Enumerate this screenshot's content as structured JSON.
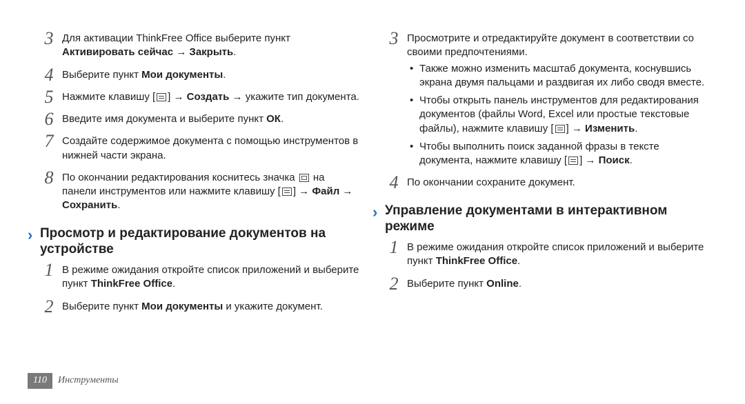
{
  "left": {
    "steps": [
      {
        "num": "3",
        "parts": [
          {
            "t": "Для активации ThinkFree Office выберите пункт "
          },
          {
            "t": "Активировать сейчас",
            "b": true
          },
          {
            "t": " → "
          },
          {
            "t": "Закрыть",
            "b": true
          },
          {
            "t": "."
          }
        ]
      },
      {
        "num": "4",
        "parts": [
          {
            "t": "Выберите пункт "
          },
          {
            "t": "Мои документы",
            "b": true
          },
          {
            "t": "."
          }
        ]
      },
      {
        "num": "5",
        "parts": [
          {
            "t": "Нажмите клавишу ["
          },
          {
            "icon": "menu"
          },
          {
            "t": "] → "
          },
          {
            "t": "Создать",
            "b": true
          },
          {
            "t": " → укажите тип документа."
          }
        ]
      },
      {
        "num": "6",
        "parts": [
          {
            "t": "Введите имя документа и выберите пункт "
          },
          {
            "t": "ОК",
            "b": true
          },
          {
            "t": "."
          }
        ]
      },
      {
        "num": "7",
        "parts": [
          {
            "t": "Создайте содержимое документа с помощью инструментов в нижней части экрана."
          }
        ]
      },
      {
        "num": "8",
        "parts": [
          {
            "t": "По окончании редактирования коснитесь значка "
          },
          {
            "icon": "save"
          },
          {
            "t": " на панели инструментов или нажмите клавишу ["
          },
          {
            "icon": "menu"
          },
          {
            "t": "] → "
          },
          {
            "t": "Файл",
            "b": true
          },
          {
            "t": " → "
          },
          {
            "t": "Сохранить",
            "b": true
          },
          {
            "t": "."
          }
        ]
      }
    ],
    "heading": "Просмотр и редактирование документов на устройстве",
    "steps2": [
      {
        "num": "1",
        "parts": [
          {
            "t": "В режиме ожидания откройте список приложений и выберите пункт "
          },
          {
            "t": "ThinkFree Office",
            "b": true
          },
          {
            "t": "."
          }
        ]
      },
      {
        "num": "2",
        "parts": [
          {
            "t": "Выберите пункт "
          },
          {
            "t": "Мои документы",
            "b": true
          },
          {
            "t": " и укажите документ."
          }
        ]
      }
    ]
  },
  "right": {
    "step3": {
      "num": "3",
      "intro": "Просмотрите и отредактируйте документ в соответствии со своими предпочтениями.",
      "bullets": [
        [
          {
            "t": "Также можно изменить масштаб документа, коснувшись экрана двумя пальцами и раздвигая их либо сводя вместе."
          }
        ],
        [
          {
            "t": "Чтобы открыть панель инструментов для редактирования документов (файлы Word, Excel или простые текстовые файлы), нажмите клавишу ["
          },
          {
            "icon": "menu"
          },
          {
            "t": "] → "
          },
          {
            "t": "Изменить",
            "b": true
          },
          {
            "t": "."
          }
        ],
        [
          {
            "t": "Чтобы выполнить поиск заданной фразы в тексте документа, нажмите клавишу ["
          },
          {
            "icon": "menu"
          },
          {
            "t": "] → "
          },
          {
            "t": "Поиск",
            "b": true
          },
          {
            "t": "."
          }
        ]
      ]
    },
    "step4": {
      "num": "4",
      "parts": [
        {
          "t": "По окончании сохраните документ."
        }
      ]
    },
    "heading": "Управление документами в интерактивном режиме",
    "steps2": [
      {
        "num": "1",
        "parts": [
          {
            "t": "В режиме ожидания откройте список приложений и выберите пункт "
          },
          {
            "t": "ThinkFree Office",
            "b": true
          },
          {
            "t": "."
          }
        ]
      },
      {
        "num": "2",
        "parts": [
          {
            "t": "Выберите пункт "
          },
          {
            "t": "Online",
            "b": true
          },
          {
            "t": "."
          }
        ]
      }
    ]
  },
  "footer": {
    "page": "110",
    "section": "Инструменты"
  }
}
